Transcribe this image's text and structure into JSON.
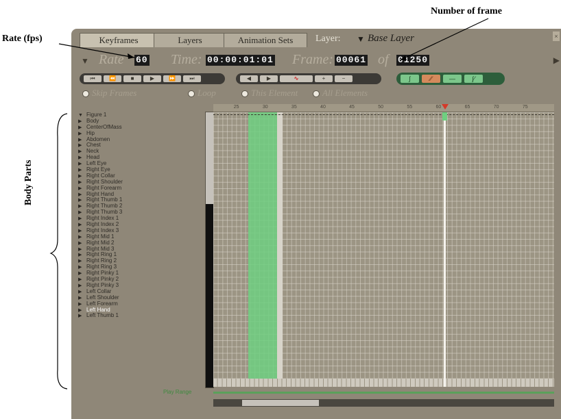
{
  "annotations": {
    "rate_label": "Rate (fps)",
    "frames_label": "Number of frame",
    "body_label": "Body Parts"
  },
  "tabs": [
    {
      "label": "Keyframes"
    },
    {
      "label": "Layers"
    },
    {
      "label": "Animation Sets"
    }
  ],
  "layer": {
    "label": "Layer:",
    "value": "Base Layer"
  },
  "controls": {
    "rate_label": "Rate",
    "rate_value": "60",
    "time_label": "Time:",
    "time_value": "00:00:01:01",
    "frame_label": "Frame:",
    "frame_value": "00061",
    "of_label": "of",
    "total_frames": "01250"
  },
  "options": {
    "skip_frames": "Skip Frames",
    "loop": "Loop",
    "this_element": "This Element",
    "all_elements": "All Elements"
  },
  "ruler_ticks": [
    "25",
    "30",
    "35",
    "40",
    "45",
    "50",
    "55",
    "60",
    "65",
    "70",
    "75"
  ],
  "tree": [
    "Figure 1",
    "Body",
    "CenterOfMass",
    "Hip",
    "Abdomen",
    "Chest",
    "Neck",
    "Head",
    "Left Eye",
    "Right Eye",
    "Right Collar",
    "Right Shoulder",
    "Right Forearm",
    "Right Hand",
    "Right Thumb 1",
    "Right Thumb 2",
    "Right Thumb 3",
    "Right Index 1",
    "Right Index 2",
    "Right Index 3",
    "Right Mid 1",
    "Right Mid 2",
    "Right Mid 3",
    "Right Ring 1",
    "Right Ring 2",
    "Right Ring 3",
    "Right Pinky 1",
    "Right Pinky 2",
    "Right Pinky 3",
    "Left Collar",
    "Left Shoulder",
    "Left Forearm",
    "Left Hand",
    "Left Thumb 1"
  ],
  "selected_tree_item": "Left Hand",
  "play_range_label": "Play Range",
  "colors": {
    "panel": "#8f8778",
    "keyframe_green": "#6fcf80",
    "current_frame_marker": "#d43a2a"
  },
  "timeline": {
    "visible_start_frame": 21,
    "visible_end_frame": 80,
    "current_frame": 61,
    "keyframe_range_start": 27,
    "keyframe_range_end": 32
  }
}
